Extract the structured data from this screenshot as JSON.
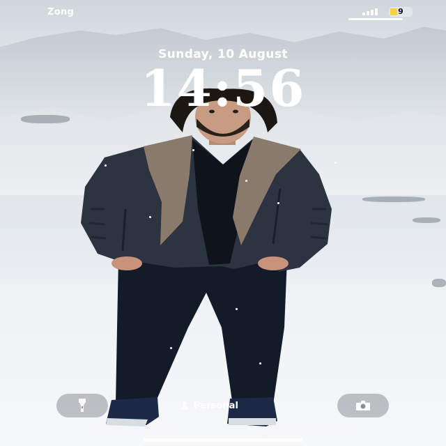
{
  "status_bar": {
    "carrier": "Zong",
    "battery_level": "9",
    "signal_bars": 4
  },
  "lock_screen": {
    "date": "Sunday, 10 August",
    "time": "14:56"
  },
  "bottom_bar": {
    "flashlight_icon": "flashlight-icon",
    "focus_mode_icon": "person-icon",
    "focus_mode_label": "Personal",
    "camera_icon": "camera-icon"
  },
  "colors": {
    "text": "#ffffff",
    "battery_fill": "#f3d23b",
    "jacket": "#2b3440",
    "collar": "#8a7a6c",
    "pants": "#141b28"
  }
}
